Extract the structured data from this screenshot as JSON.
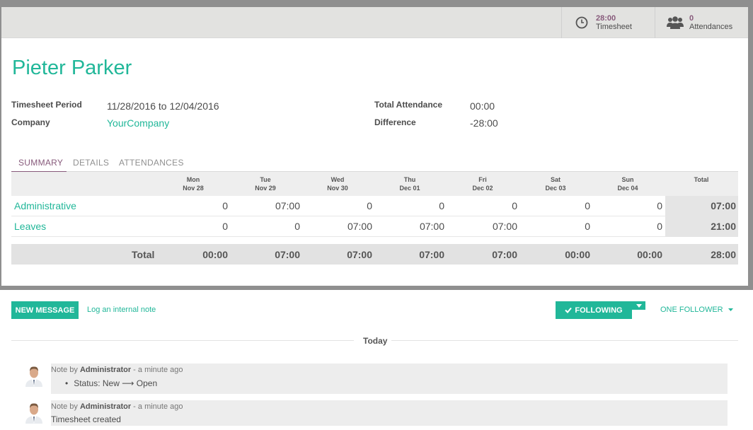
{
  "stat_buttons": {
    "timesheet": {
      "value": "28:00",
      "label": "Timesheet",
      "icon": "clock-icon"
    },
    "attendances": {
      "value": "0",
      "label": "Attendances",
      "icon": "users-icon"
    }
  },
  "employee_name": "Pieter Parker",
  "fields": {
    "period_label": "Timesheet Period",
    "period_value": "11/28/2016 to 12/04/2016",
    "company_label": "Company",
    "company_value": "YourCompany",
    "total_attendance_label": "Total Attendance",
    "total_attendance_value": "00:00",
    "difference_label": "Difference",
    "difference_value": "-28:00"
  },
  "tabs": [
    {
      "label": "SUMMARY",
      "active": true
    },
    {
      "label": "DETAILS",
      "active": false
    },
    {
      "label": "ATTENDANCES",
      "active": false
    }
  ],
  "grid": {
    "columns": [
      {
        "day": "Mon",
        "date": "Nov 28"
      },
      {
        "day": "Tue",
        "date": "Nov 29"
      },
      {
        "day": "Wed",
        "date": "Nov 30"
      },
      {
        "day": "Thu",
        "date": "Dec 01"
      },
      {
        "day": "Fri",
        "date": "Dec 02"
      },
      {
        "day": "Sat",
        "date": "Dec 03"
      },
      {
        "day": "Sun",
        "date": "Dec 04"
      }
    ],
    "total_header": "Total",
    "rows": [
      {
        "name": "Administrative",
        "cells": [
          "0",
          "07:00",
          "0",
          "0",
          "0",
          "0",
          "0"
        ],
        "total": "07:00"
      },
      {
        "name": "Leaves",
        "cells": [
          "0",
          "0",
          "07:00",
          "07:00",
          "07:00",
          "0",
          "0"
        ],
        "total": "21:00"
      }
    ],
    "footer_label": "Total",
    "footer_cells": [
      "00:00",
      "07:00",
      "07:00",
      "07:00",
      "07:00",
      "00:00",
      "00:00"
    ],
    "footer_total": "28:00"
  },
  "chatter": {
    "new_message": "NEW MESSAGE",
    "log_note": "Log an internal note",
    "following": "FOLLOWING",
    "followers": "ONE FOLLOWER",
    "date_separator": "Today",
    "messages": [
      {
        "prefix": "Note by",
        "author": "Administrator",
        "time": "- a minute ago",
        "body": "Status: New ⟶ Open"
      },
      {
        "prefix": "Note by",
        "author": "Administrator",
        "time": "- a minute ago",
        "body": "Timesheet created"
      }
    ]
  },
  "colors": {
    "brand": "#21b799",
    "accent": "#875a7b"
  }
}
